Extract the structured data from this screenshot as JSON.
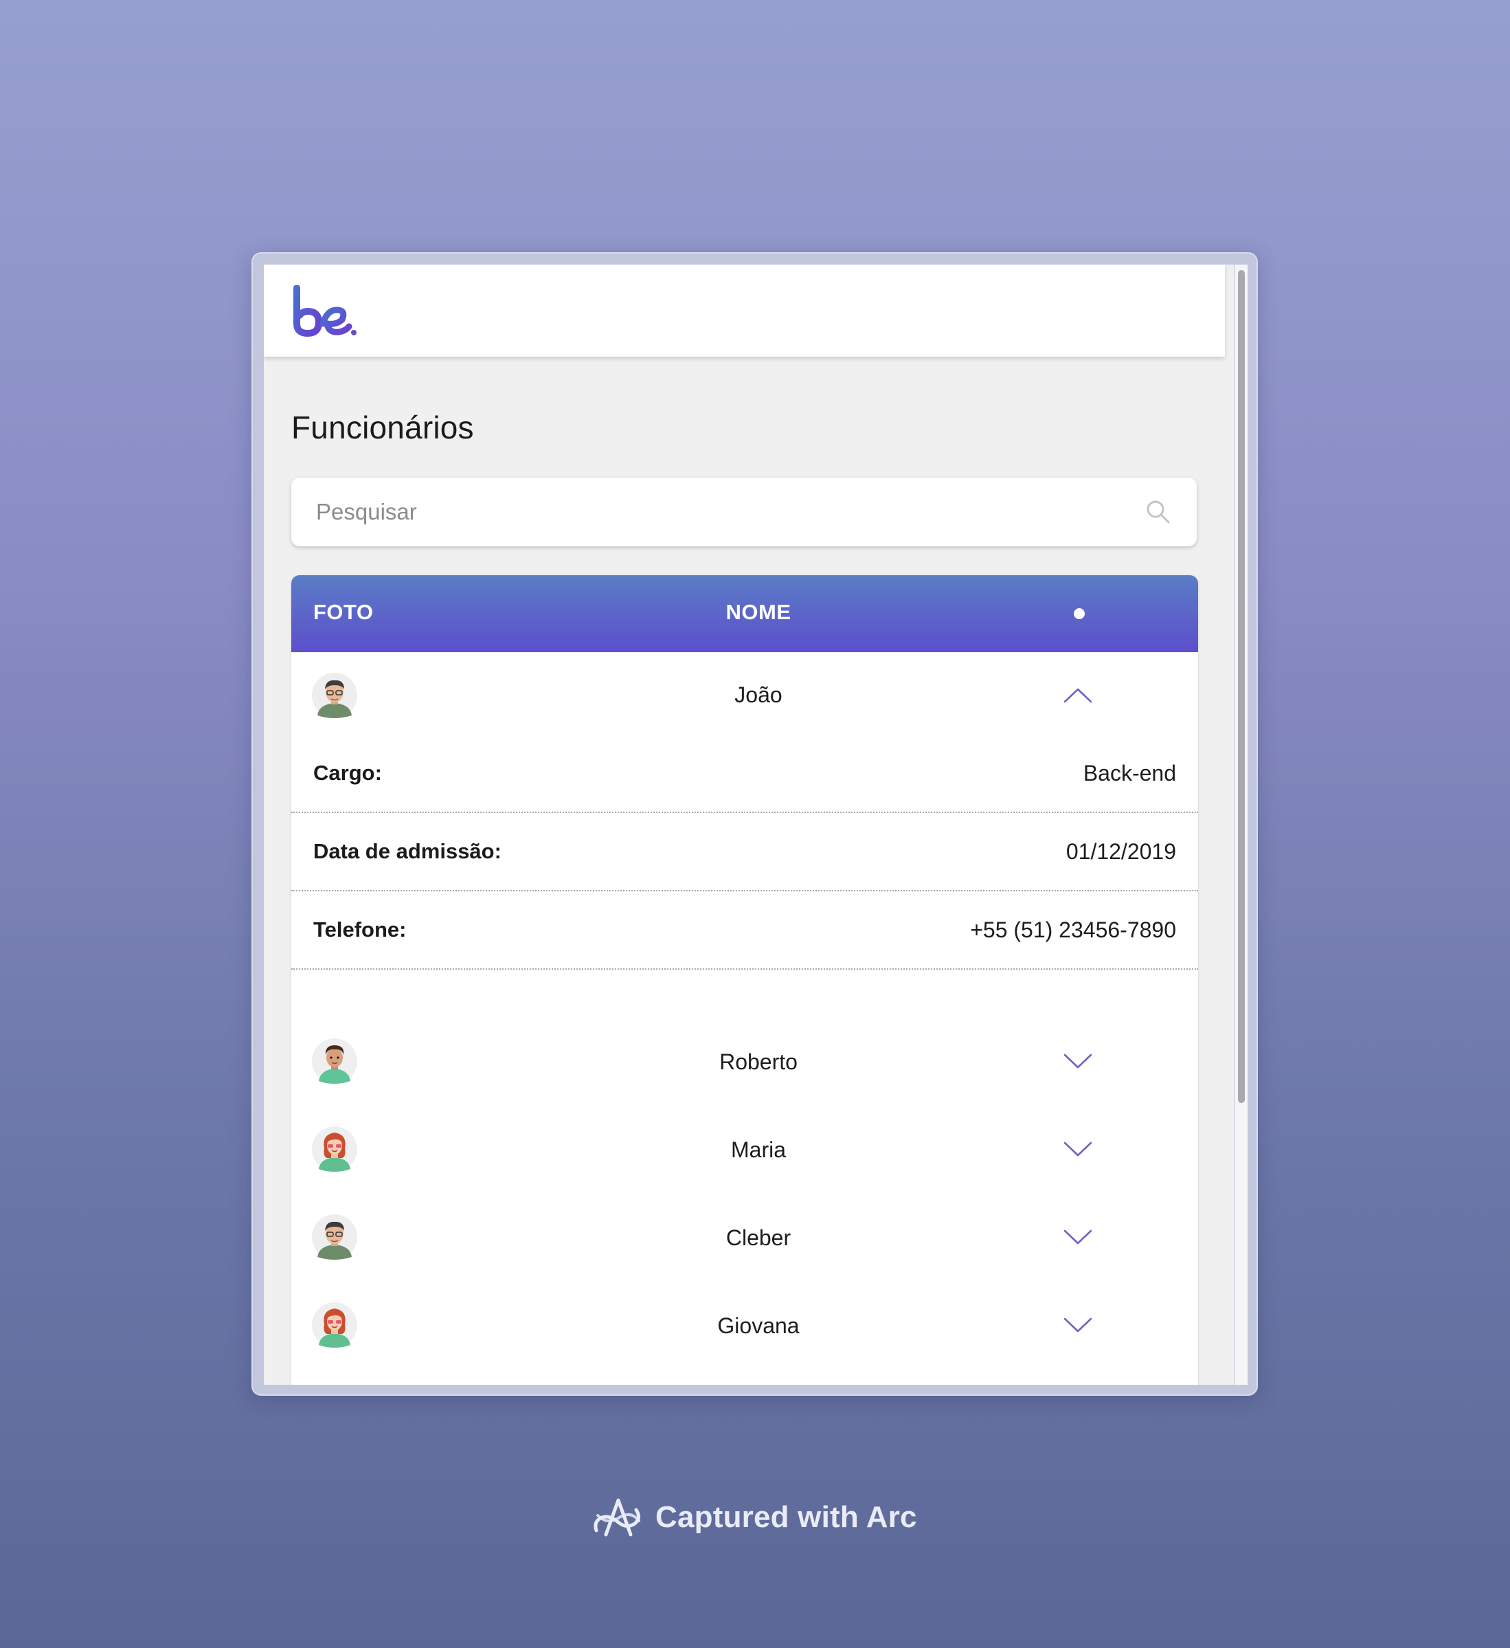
{
  "app": {
    "logo_text": "be.",
    "brand_color": "#5a4fcf",
    "page_title": "Funcionários"
  },
  "search": {
    "placeholder": "Pesquisar",
    "value": "",
    "icon": "search-icon"
  },
  "table": {
    "columns": [
      "FOTO",
      "NOME",
      "•"
    ],
    "header_gradient": [
      "#5b7dc6",
      "#5c4fcc"
    ],
    "expanded_employee": {
      "name": "João",
      "avatar": "avatar-man-glasses",
      "details": [
        {
          "label": "Cargo:",
          "value": "Back-end"
        },
        {
          "label": "Data de admissão:",
          "value": "01/12/2019"
        },
        {
          "label": "Telefone:",
          "value": "+55 (51) 23456-7890"
        }
      ]
    },
    "employees": [
      {
        "name": "Roberto",
        "avatar": "avatar-man-curly"
      },
      {
        "name": "Maria",
        "avatar": "avatar-woman-redhead"
      },
      {
        "name": "Cleber",
        "avatar": "avatar-man-glasses"
      },
      {
        "name": "Giovana",
        "avatar": "avatar-woman-redhead"
      }
    ]
  },
  "footer": {
    "caption": "Captured with Arc"
  }
}
